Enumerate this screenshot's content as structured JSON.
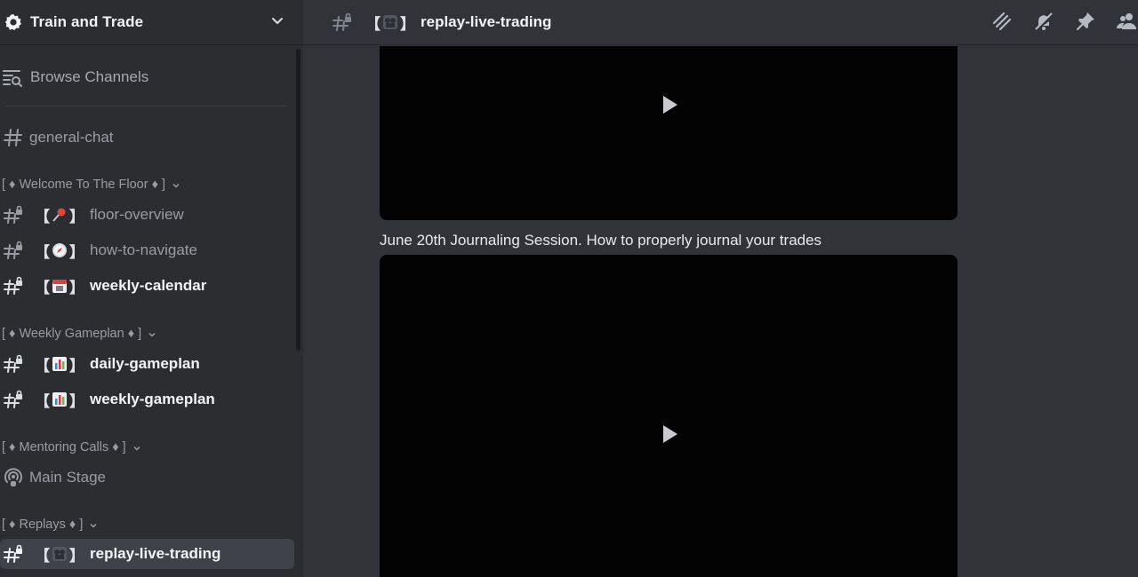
{
  "server": {
    "name": "Train and Trade"
  },
  "sidebar": {
    "browse_label": "Browse Channels",
    "general": "general-chat",
    "categories": [
      {
        "label": "[ ♦ Welcome To The Floor ♦ ]"
      },
      {
        "label": "[ ♦ Weekly Gameplan ♦ ]"
      },
      {
        "label": "[ ♦ Mentoring Calls ♦ ]"
      },
      {
        "label": "[ ♦ Replays ♦ ]"
      }
    ],
    "channels": {
      "floor_overview": "floor-overview",
      "how_to_navigate": "how-to-navigate",
      "weekly_calendar": "weekly-calendar",
      "daily_gameplan": "daily-gameplan",
      "weekly_gameplan": "weekly-gameplan",
      "main_stage": "Main Stage",
      "replay_live_trading": "replay-live-trading"
    },
    "brackets": {
      "open": "【",
      "close": "】"
    }
  },
  "topbar": {
    "channel_title": "replay-live-trading"
  },
  "messages": [
    {
      "text": "June 20th Journaling Session. How to properly journal your trades"
    }
  ],
  "colors": {
    "background": "#313338",
    "sidebar": "#2b2d31",
    "active": "#404249",
    "video": "#030304"
  },
  "icons": [
    "gear-icon",
    "chevron-down-icon",
    "browse-channels-icon",
    "hash-icon",
    "hash-lock-icon",
    "stage-icon",
    "threads-icon",
    "mute-icon",
    "pin-icon",
    "members-icon",
    "play-icon"
  ]
}
